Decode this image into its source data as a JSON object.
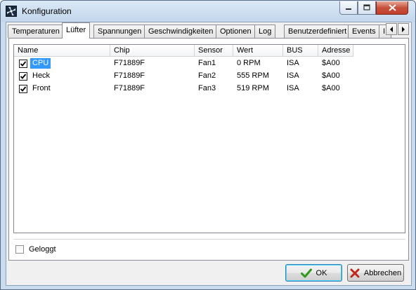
{
  "window": {
    "title": "Konfiguration",
    "icon": "fan-icon"
  },
  "tabs": [
    {
      "label": "Temperaturen",
      "active": false
    },
    {
      "label": "Lüfter",
      "active": true
    },
    {
      "label": "Spannungen",
      "active": false
    },
    {
      "label": "Geschwindigkeiten",
      "active": false
    },
    {
      "label": "Optionen",
      "active": false
    },
    {
      "label": "Log",
      "active": false
    },
    {
      "label": "Benutzerdefiniert",
      "active": false
    },
    {
      "label": "Events",
      "active": false
    },
    {
      "label": "I",
      "active": false
    }
  ],
  "list": {
    "columns": [
      "Name",
      "Chip",
      "Sensor",
      "Wert",
      "BUS",
      "Adresse"
    ],
    "rows": [
      {
        "checked": true,
        "selected": true,
        "name": "CPU",
        "chip": "F71889F",
        "sensor": "Fan1",
        "wert": "0 RPM",
        "bus": "ISA",
        "adresse": "$A00"
      },
      {
        "checked": true,
        "selected": false,
        "name": "Heck",
        "chip": "F71889F",
        "sensor": "Fan2",
        "wert": "555 RPM",
        "bus": "ISA",
        "adresse": "$A00"
      },
      {
        "checked": true,
        "selected": false,
        "name": "Front",
        "chip": "F71889F",
        "sensor": "Fan3",
        "wert": "519 RPM",
        "bus": "ISA",
        "adresse": "$A00"
      }
    ]
  },
  "geloggt": {
    "label": "Geloggt",
    "checked": false
  },
  "buttons": {
    "ok": "OK",
    "cancel": "Abbrechen"
  },
  "colors": {
    "selection": "#3399ff",
    "ok_check": "#2f9a1d",
    "cancel_x": "#c0281e"
  }
}
